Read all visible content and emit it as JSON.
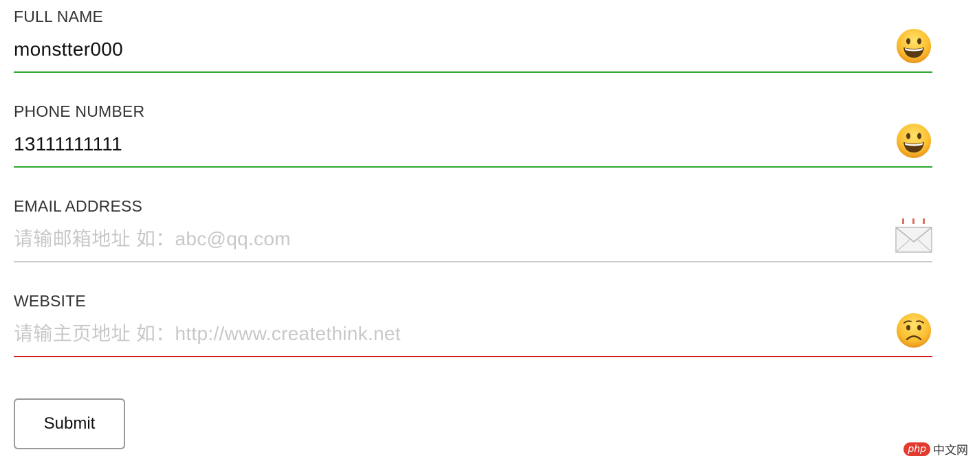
{
  "fields": [
    {
      "label": "FULL NAME",
      "value": "monstter000",
      "placeholder": "",
      "status": "valid",
      "status_icon": "grinning-face-icon",
      "underline_color": "#2aa830"
    },
    {
      "label": "PHONE NUMBER",
      "value": "13111111111",
      "placeholder": "",
      "status": "valid",
      "status_icon": "grinning-face-icon",
      "underline_color": "#2aa830"
    },
    {
      "label": "EMAIL ADDRESS",
      "value": "",
      "placeholder": "请输邮箱地址 如：abc@qq.com",
      "status": "empty",
      "status_icon": "envelope-icon",
      "underline_color": "#cccccc"
    },
    {
      "label": "WEBSITE",
      "value": "",
      "placeholder": "请输主页地址 如：http://www.createthink.net",
      "status": "invalid",
      "status_icon": "worried-face-icon",
      "underline_color": "#d81e1e"
    }
  ],
  "submit": {
    "label": "Submit"
  },
  "watermark": {
    "badge": "php",
    "text": "中文网"
  },
  "colors": {
    "valid": "#2aa830",
    "invalid": "#d81e1e",
    "neutral": "#cccccc",
    "label": "#333333",
    "placeholder": "#c8c8c8"
  }
}
